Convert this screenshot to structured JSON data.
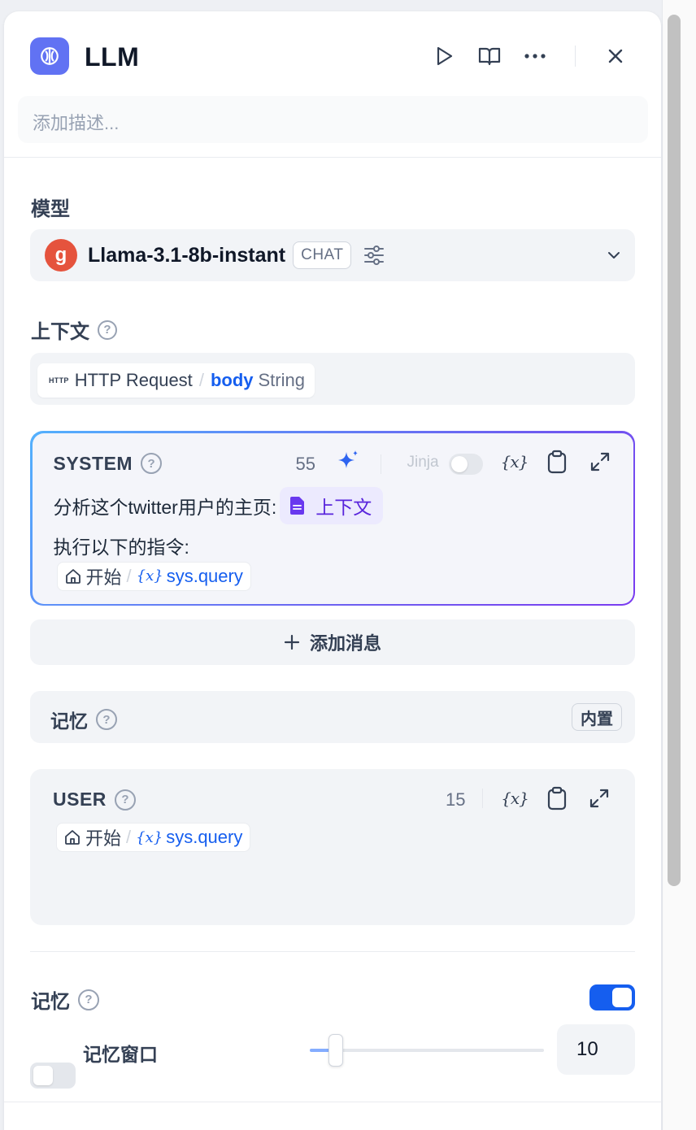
{
  "header": {
    "title": "LLM",
    "description_placeholder": "添加描述..."
  },
  "model": {
    "label": "模型",
    "name": "Llama-3.1-8b-instant",
    "mode_badge": "CHAT",
    "logo_glyph": "g"
  },
  "context": {
    "label": "上下文",
    "chip_node_icon": "HTTP",
    "chip_node": "HTTP Request",
    "chip_var": "body",
    "chip_type": "String"
  },
  "system_prompt": {
    "role": "SYSTEM",
    "count": "55",
    "jinja_label": "Jinja",
    "line1": "分析这个twitter用户的主页:",
    "context_tag": "上下文",
    "line2": "执行以下的指令:",
    "var_node": "开始",
    "var_name": "sys.query"
  },
  "add_message": {
    "label": "添加消息"
  },
  "memory_row": {
    "label": "记忆",
    "badge": "内置"
  },
  "user_prompt": {
    "role": "USER",
    "count": "15",
    "var_node": "开始",
    "var_name": "sys.query"
  },
  "memory_settings": {
    "label": "记忆",
    "enabled": true,
    "window_label": "记忆窗口",
    "window_enabled": false,
    "window_value": "10",
    "slider_fraction": 0.1
  },
  "colors": {
    "accent": "#155eef",
    "node_icon": "#6172f3",
    "model_logo": "#e5533d",
    "context_tag": "#5925dc"
  }
}
